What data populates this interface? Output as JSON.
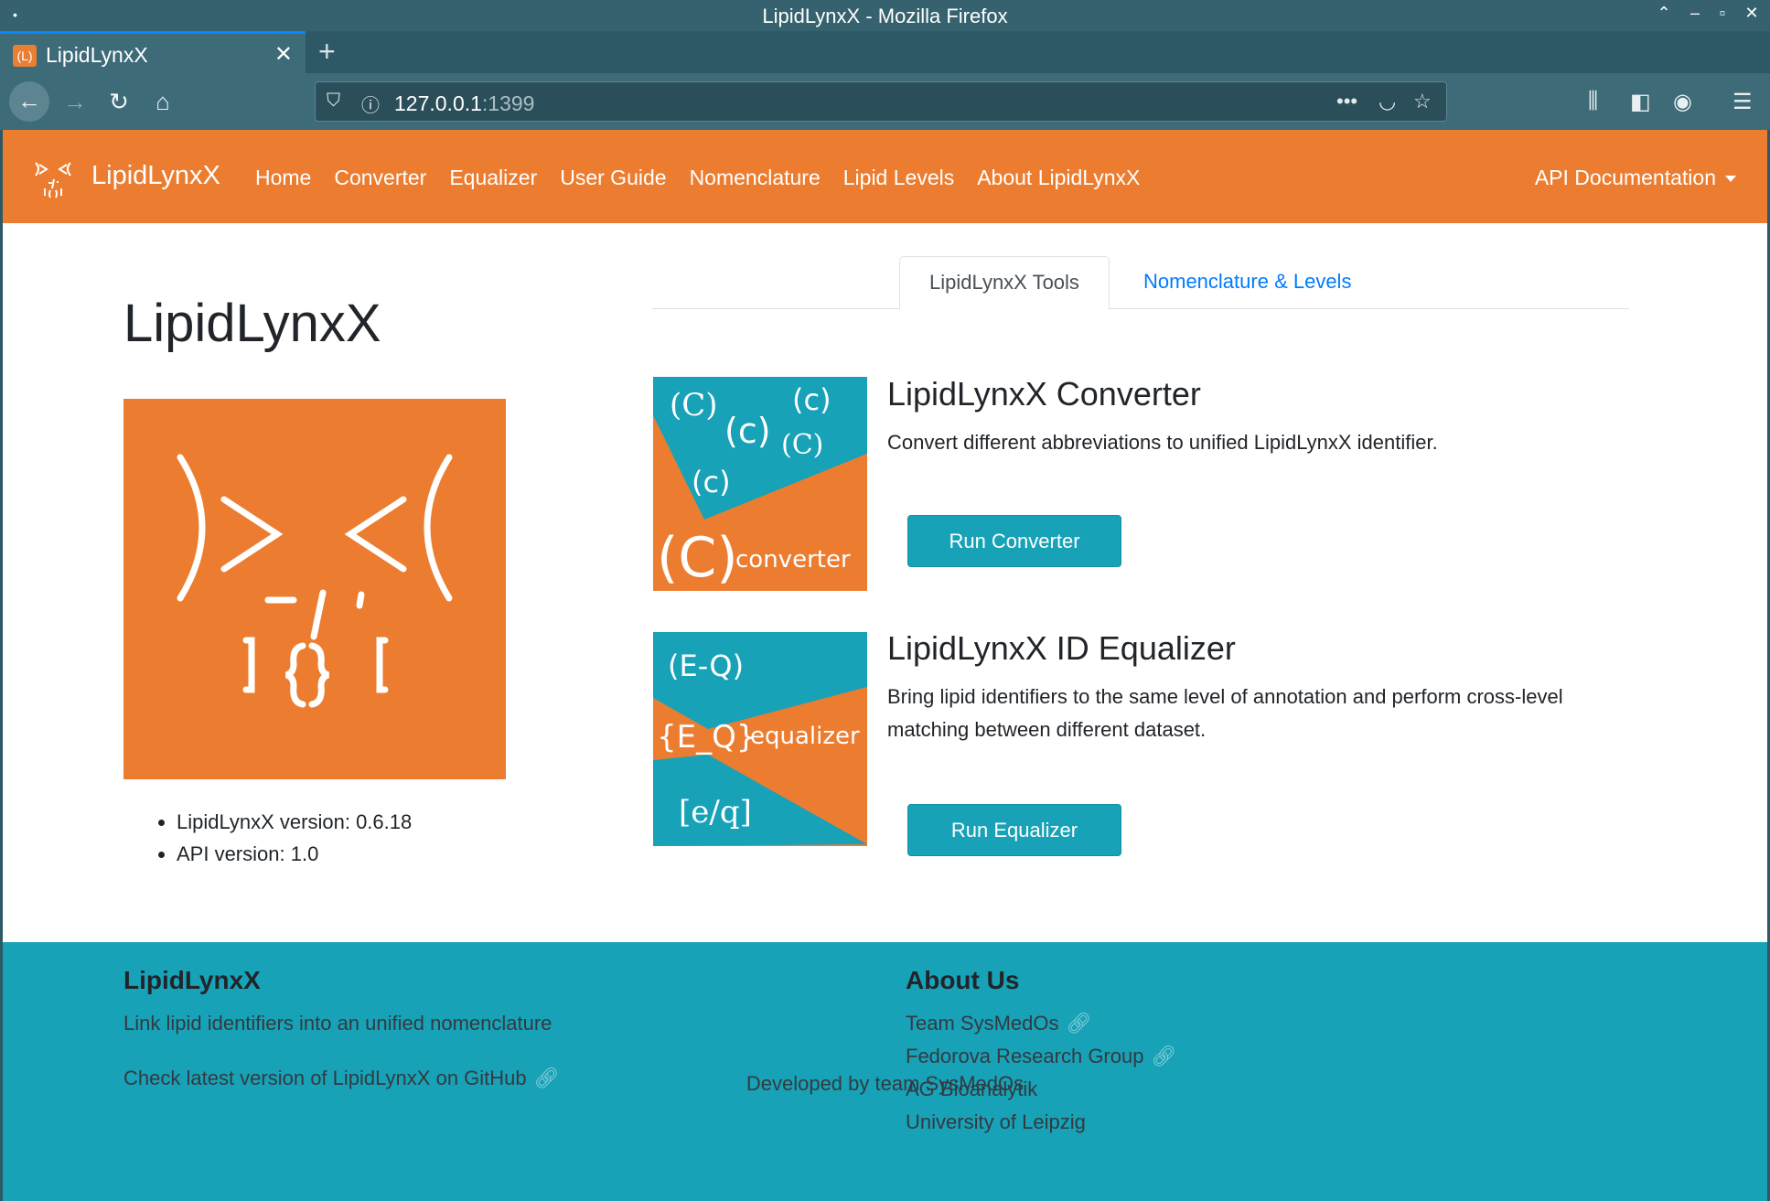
{
  "window": {
    "title": "LipidLynxX - Mozilla Firefox",
    "controls": [
      "⌃",
      "–",
      "▫",
      "✕"
    ]
  },
  "browser": {
    "tab_title": "LipidLynxX",
    "tab_favicon_text": "(L)",
    "url_host": "127.0.0.1",
    "url_port": ":1399"
  },
  "nav": {
    "brand": "LipidLynxX",
    "links": [
      "Home",
      "Converter",
      "Equalizer",
      "User Guide",
      "Nomenclature",
      "Lipid Levels",
      "About LipidLynxX"
    ],
    "api_doc": "API Documentation"
  },
  "main": {
    "title": "LipidLynxX",
    "versions": [
      "LipidLynxX version: 0.6.18",
      "API version: 1.0"
    ],
    "tabs": [
      "LipidLynxX Tools",
      "Nomenclature & Levels"
    ],
    "converter": {
      "title": "LipidLynxX Converter",
      "description": "Convert different abbreviations to unified LipidLynxX identifier.",
      "button": "Run Converter",
      "img_text": [
        "(C)",
        "(c)",
        "(c)",
        "(C)",
        "(c)",
        "(C)",
        "converter"
      ]
    },
    "equalizer": {
      "title": "LipidLynxX ID Equalizer",
      "description": "Bring lipid identifiers to the same level of annotation and perform cross-level matching between different dataset.",
      "button": "Run Equalizer",
      "img_text": [
        "(E-Q)",
        "{E_Q}",
        "equalizer",
        "[e/q]"
      ]
    }
  },
  "footer": {
    "left_heading": "LipidLynxX",
    "tagline": "Link lipid identifiers into an unified nomenclature",
    "github": "Check latest version of LipidLynxX on GitHub",
    "right_heading": "About Us",
    "about_links": [
      "Team SysMedOs",
      "Fedorova Research Group",
      "AG Bioanalytik",
      "University of Leipzig"
    ],
    "developed_by": "Developed by team SysMedOs"
  },
  "colors": {
    "brand_orange": "#ec7d30",
    "teal": "#17a2b8",
    "browser_chrome": "#3d6b78",
    "link_blue": "#007bff"
  },
  "icons": [
    "back-icon",
    "forward-icon",
    "reload-icon",
    "home-icon",
    "shield-icon",
    "info-icon",
    "more-icon",
    "pocket-icon",
    "star-icon",
    "library-icon",
    "sidebar-icon",
    "account-icon",
    "menu-icon",
    "link-icon"
  ]
}
